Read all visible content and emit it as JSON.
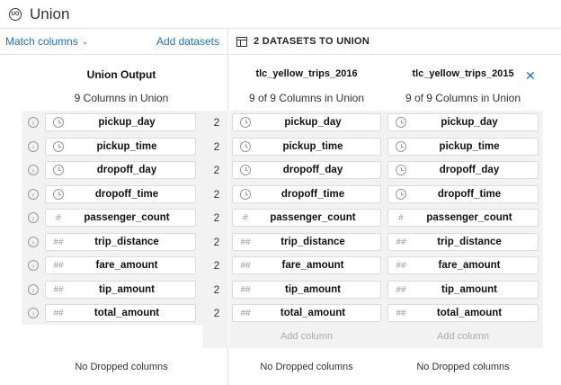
{
  "app": {
    "title": "Union",
    "logo_text": "UO"
  },
  "left_panel": {
    "match_label": "Match columns",
    "add_datasets_label": "Add datasets",
    "heading": "Union Output",
    "subheading": "9 Columns in Union",
    "dropped": "No Dropped columns",
    "rows": [
      {
        "name": "pickup_day",
        "type_icon": "clock-icon",
        "count": "2"
      },
      {
        "name": "pickup_time",
        "type_icon": "clock-icon",
        "count": "2"
      },
      {
        "name": "dropoff_day",
        "type_icon": "clock-icon",
        "count": "2"
      },
      {
        "name": "dropoff_time",
        "type_icon": "clock-icon",
        "count": "2"
      },
      {
        "name": "passenger_count",
        "type_icon": "integer-icon",
        "type_glyph": "#",
        "count": "2"
      },
      {
        "name": "trip_distance",
        "type_icon": "decimal-icon",
        "type_glyph": "##",
        "count": "2"
      },
      {
        "name": "fare_amount",
        "type_icon": "decimal-icon",
        "type_glyph": "##",
        "count": "2"
      },
      {
        "name": "tip_amount",
        "type_icon": "decimal-icon",
        "type_glyph": "##",
        "count": "2"
      },
      {
        "name": "total_amount",
        "type_icon": "decimal-icon",
        "type_glyph": "##",
        "count": "2"
      }
    ]
  },
  "right_panel": {
    "header": "2 DATASETS TO UNION",
    "datasets": [
      {
        "name": "tlc_yellow_trips_2016",
        "summary": "9 of 9 Columns in Union",
        "add_column": "Add column",
        "dropped": "No Dropped columns",
        "columns": [
          "pickup_day",
          "pickup_time",
          "dropoff_day",
          "dropoff_time",
          "passenger_count",
          "trip_distance",
          "fare_amount",
          "tip_amount",
          "total_amount"
        ]
      },
      {
        "name": "tlc_yellow_trips_2015",
        "summary": "9 of 9 Columns in Union",
        "add_column": "Add column",
        "dropped": "No Dropped columns",
        "columns": [
          "pickup_day",
          "pickup_time",
          "dropoff_day",
          "dropoff_time",
          "passenger_count",
          "trip_distance",
          "fare_amount",
          "tip_amount",
          "total_amount"
        ]
      }
    ]
  },
  "colors": {
    "accent": "#1a73c8",
    "band": "#f2f2f2"
  }
}
